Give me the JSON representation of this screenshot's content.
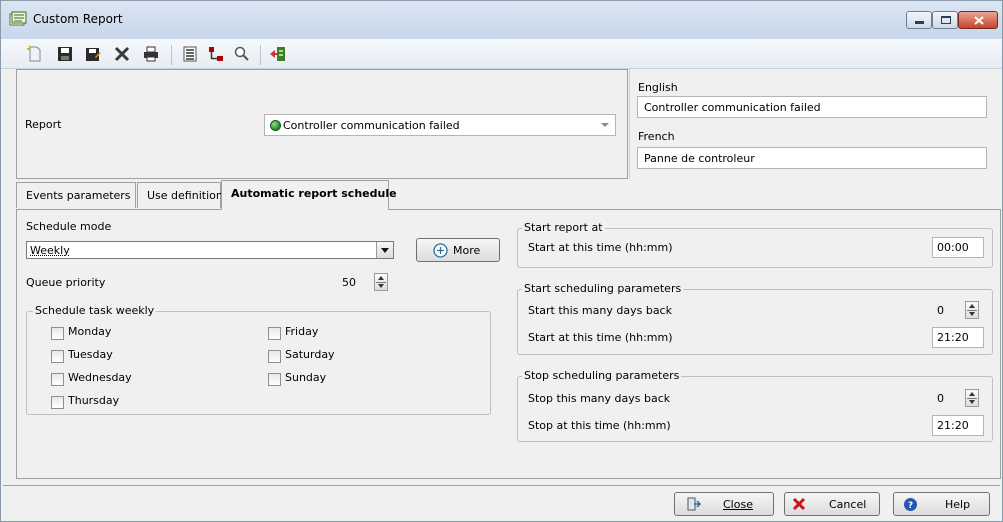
{
  "window": {
    "title": "Custom Report"
  },
  "toolbar": {
    "icons": [
      "new-doc-icon",
      "save-icon",
      "save-as-icon",
      "delete-icon",
      "print-icon",
      "list-icon",
      "hierarchy-icon",
      "search-icon",
      "export-icon"
    ]
  },
  "header": {
    "report_label": "Report",
    "report_value": "Controller communication failed",
    "english_label": "English",
    "english_value": "Controller communication failed",
    "french_label": "French",
    "french_value": "Panne de controleur"
  },
  "tabs": [
    {
      "label": "Events parameters"
    },
    {
      "label": "Use definition"
    },
    {
      "label": "Automatic report schedule"
    }
  ],
  "schedule": {
    "mode_label": "Schedule mode",
    "mode_value": "Weekly",
    "more_label": "More",
    "priority_label": "Queue priority",
    "priority_value": "50",
    "weekly_title": "Schedule task weekly",
    "days": {
      "monday": "Monday",
      "tuesday": "Tuesday",
      "wednesday": "Wednesday",
      "thursday": "Thursday",
      "friday": "Friday",
      "saturday": "Saturday",
      "sunday": "Sunday"
    }
  },
  "start_report": {
    "title": "Start report at",
    "time_label": "Start at this time (hh:mm)",
    "time_value": "00:00"
  },
  "start_params": {
    "title": "Start scheduling parameters",
    "days_label": "Start this many days back",
    "days_value": "0",
    "time_label": "Start at this time (hh:mm)",
    "time_value": "21:20"
  },
  "stop_params": {
    "title": "Stop scheduling parameters",
    "days_label": "Stop this many days back",
    "days_value": "0",
    "time_label": "Stop at this time (hh:mm)",
    "time_value": "21:20"
  },
  "footer": {
    "close_label": "Close",
    "cancel_label": "Cancel",
    "help_label": "Help"
  }
}
